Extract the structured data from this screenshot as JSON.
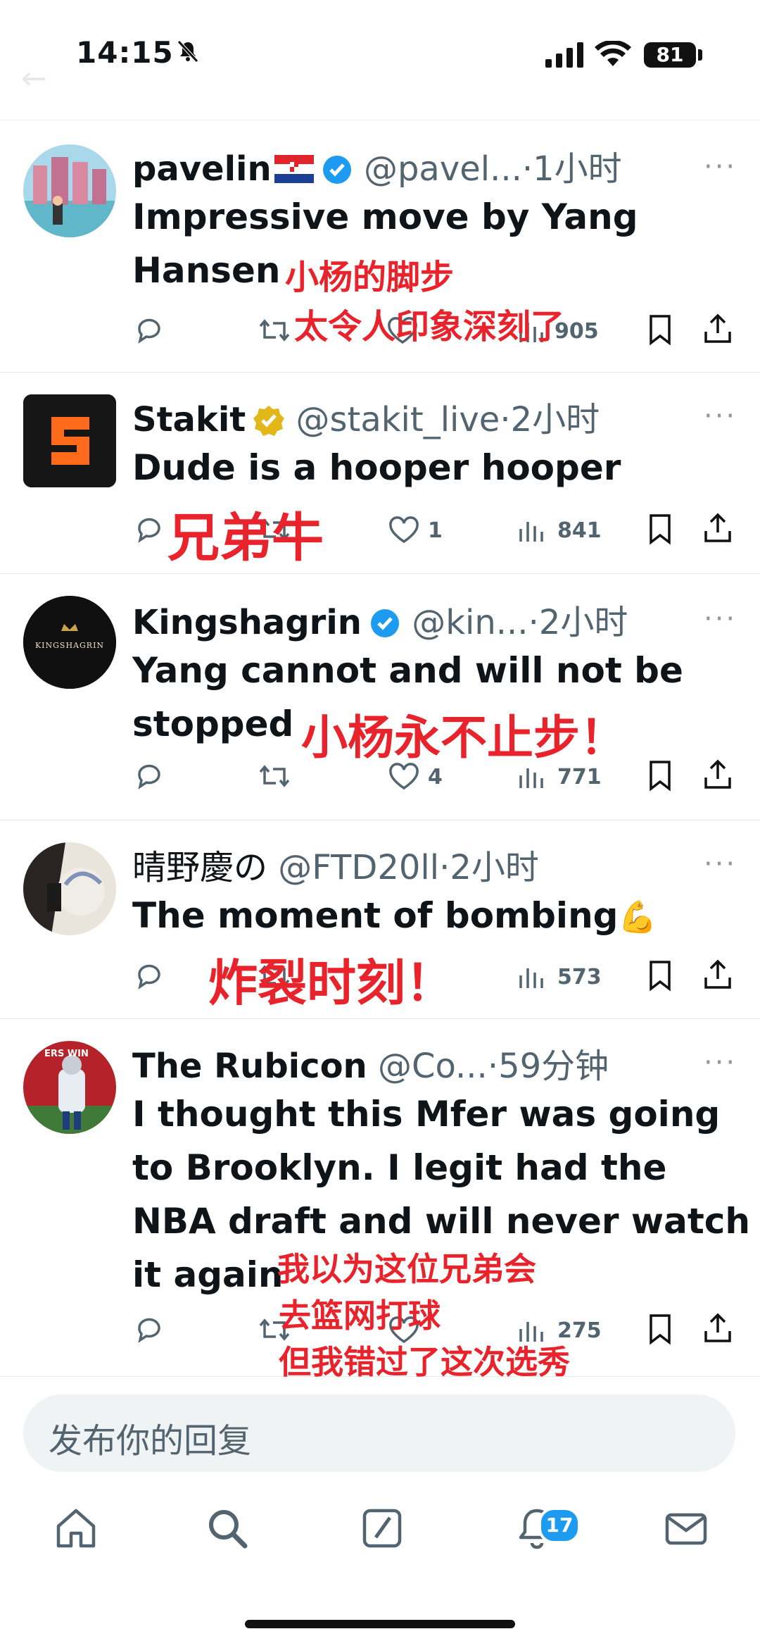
{
  "status_bar": {
    "time": "14:15",
    "battery": "81"
  },
  "tweets": [
    {
      "display_name": "pavelin",
      "handle": "@pavel...",
      "time": "1小时",
      "text": "Impressive move by Yang Hansen",
      "overlay": [
        "小杨的脚步",
        "太令人印象深刻了"
      ],
      "likes": "",
      "views": "905"
    },
    {
      "display_name": "Stakit",
      "handle": "@stakit_live",
      "time": "2小时",
      "text": "Dude is a hooper hooper",
      "overlay": [
        "兄弟牛"
      ],
      "likes": "1",
      "views": "841"
    },
    {
      "display_name": "Kingshagrin",
      "handle": "@kin...",
      "time": "2小时",
      "text": "Yang cannot and will not be stopped",
      "overlay": [
        "小杨永不止步！"
      ],
      "likes": "4",
      "views": "771",
      "avatar_text": "KINGSHAGRIN"
    },
    {
      "display_name": "晴野慶の",
      "handle": "@FTD20ll",
      "time": "2小时",
      "text": "The moment of bombing",
      "emoji": "💪",
      "overlay": [
        "炸裂时刻！"
      ],
      "likes": "",
      "views": "573"
    },
    {
      "display_name": "The Rubicon",
      "handle": "@Co...",
      "time": "59分钟",
      "text": "I thought this Mfer was going to Brooklyn. I legit had the NBA draft and will never watch it again",
      "overlay": [
        "我以为这位兄弟会",
        "去篮网打球",
        "但我错过了这次选秀"
      ],
      "likes": "",
      "views": "275",
      "avatar_text": "ERS WIN"
    }
  ],
  "reply_placeholder": "发布你的回复",
  "nav": {
    "notifications_badge": "17"
  },
  "colors": {
    "accent": "#1d9bf0",
    "overlay_red": "#e8232b",
    "gold_badge": "#e2b719"
  }
}
